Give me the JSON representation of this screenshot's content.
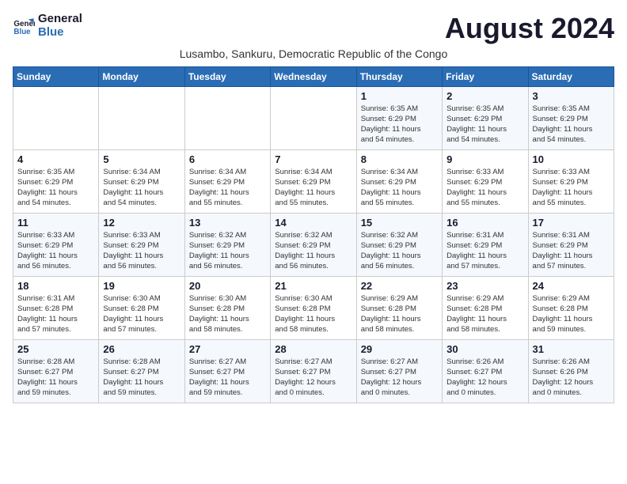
{
  "logo": {
    "line1": "General",
    "line2": "Blue"
  },
  "title": "August 2024",
  "subtitle": "Lusambo, Sankuru, Democratic Republic of the Congo",
  "days_of_week": [
    "Sunday",
    "Monday",
    "Tuesday",
    "Wednesday",
    "Thursday",
    "Friday",
    "Saturday"
  ],
  "weeks": [
    [
      {
        "day": "",
        "info": ""
      },
      {
        "day": "",
        "info": ""
      },
      {
        "day": "",
        "info": ""
      },
      {
        "day": "",
        "info": ""
      },
      {
        "day": "1",
        "info": "Sunrise: 6:35 AM\nSunset: 6:29 PM\nDaylight: 11 hours\nand 54 minutes."
      },
      {
        "day": "2",
        "info": "Sunrise: 6:35 AM\nSunset: 6:29 PM\nDaylight: 11 hours\nand 54 minutes."
      },
      {
        "day": "3",
        "info": "Sunrise: 6:35 AM\nSunset: 6:29 PM\nDaylight: 11 hours\nand 54 minutes."
      }
    ],
    [
      {
        "day": "4",
        "info": "Sunrise: 6:35 AM\nSunset: 6:29 PM\nDaylight: 11 hours\nand 54 minutes."
      },
      {
        "day": "5",
        "info": "Sunrise: 6:34 AM\nSunset: 6:29 PM\nDaylight: 11 hours\nand 54 minutes."
      },
      {
        "day": "6",
        "info": "Sunrise: 6:34 AM\nSunset: 6:29 PM\nDaylight: 11 hours\nand 55 minutes."
      },
      {
        "day": "7",
        "info": "Sunrise: 6:34 AM\nSunset: 6:29 PM\nDaylight: 11 hours\nand 55 minutes."
      },
      {
        "day": "8",
        "info": "Sunrise: 6:34 AM\nSunset: 6:29 PM\nDaylight: 11 hours\nand 55 minutes."
      },
      {
        "day": "9",
        "info": "Sunrise: 6:33 AM\nSunset: 6:29 PM\nDaylight: 11 hours\nand 55 minutes."
      },
      {
        "day": "10",
        "info": "Sunrise: 6:33 AM\nSunset: 6:29 PM\nDaylight: 11 hours\nand 55 minutes."
      }
    ],
    [
      {
        "day": "11",
        "info": "Sunrise: 6:33 AM\nSunset: 6:29 PM\nDaylight: 11 hours\nand 56 minutes."
      },
      {
        "day": "12",
        "info": "Sunrise: 6:33 AM\nSunset: 6:29 PM\nDaylight: 11 hours\nand 56 minutes."
      },
      {
        "day": "13",
        "info": "Sunrise: 6:32 AM\nSunset: 6:29 PM\nDaylight: 11 hours\nand 56 minutes."
      },
      {
        "day": "14",
        "info": "Sunrise: 6:32 AM\nSunset: 6:29 PM\nDaylight: 11 hours\nand 56 minutes."
      },
      {
        "day": "15",
        "info": "Sunrise: 6:32 AM\nSunset: 6:29 PM\nDaylight: 11 hours\nand 56 minutes."
      },
      {
        "day": "16",
        "info": "Sunrise: 6:31 AM\nSunset: 6:29 PM\nDaylight: 11 hours\nand 57 minutes."
      },
      {
        "day": "17",
        "info": "Sunrise: 6:31 AM\nSunset: 6:29 PM\nDaylight: 11 hours\nand 57 minutes."
      }
    ],
    [
      {
        "day": "18",
        "info": "Sunrise: 6:31 AM\nSunset: 6:28 PM\nDaylight: 11 hours\nand 57 minutes."
      },
      {
        "day": "19",
        "info": "Sunrise: 6:30 AM\nSunset: 6:28 PM\nDaylight: 11 hours\nand 57 minutes."
      },
      {
        "day": "20",
        "info": "Sunrise: 6:30 AM\nSunset: 6:28 PM\nDaylight: 11 hours\nand 58 minutes."
      },
      {
        "day": "21",
        "info": "Sunrise: 6:30 AM\nSunset: 6:28 PM\nDaylight: 11 hours\nand 58 minutes."
      },
      {
        "day": "22",
        "info": "Sunrise: 6:29 AM\nSunset: 6:28 PM\nDaylight: 11 hours\nand 58 minutes."
      },
      {
        "day": "23",
        "info": "Sunrise: 6:29 AM\nSunset: 6:28 PM\nDaylight: 11 hours\nand 58 minutes."
      },
      {
        "day": "24",
        "info": "Sunrise: 6:29 AM\nSunset: 6:28 PM\nDaylight: 11 hours\nand 59 minutes."
      }
    ],
    [
      {
        "day": "25",
        "info": "Sunrise: 6:28 AM\nSunset: 6:27 PM\nDaylight: 11 hours\nand 59 minutes."
      },
      {
        "day": "26",
        "info": "Sunrise: 6:28 AM\nSunset: 6:27 PM\nDaylight: 11 hours\nand 59 minutes."
      },
      {
        "day": "27",
        "info": "Sunrise: 6:27 AM\nSunset: 6:27 PM\nDaylight: 11 hours\nand 59 minutes."
      },
      {
        "day": "28",
        "info": "Sunrise: 6:27 AM\nSunset: 6:27 PM\nDaylight: 12 hours\nand 0 minutes."
      },
      {
        "day": "29",
        "info": "Sunrise: 6:27 AM\nSunset: 6:27 PM\nDaylight: 12 hours\nand 0 minutes."
      },
      {
        "day": "30",
        "info": "Sunrise: 6:26 AM\nSunset: 6:27 PM\nDaylight: 12 hours\nand 0 minutes."
      },
      {
        "day": "31",
        "info": "Sunrise: 6:26 AM\nSunset: 6:26 PM\nDaylight: 12 hours\nand 0 minutes."
      }
    ]
  ]
}
